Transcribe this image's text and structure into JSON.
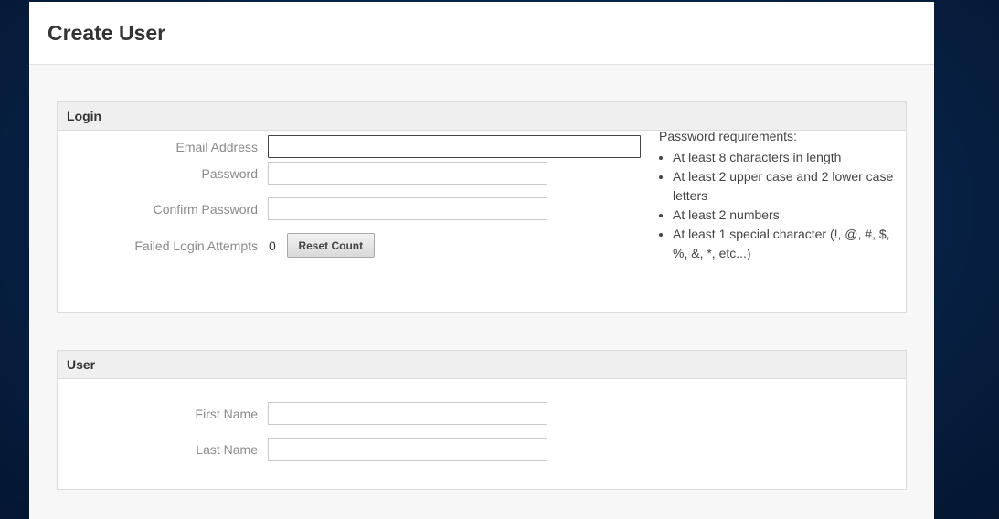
{
  "dialog": {
    "title": "Create User"
  },
  "login": {
    "heading": "Login",
    "email_label": "Email Address",
    "email_value": "",
    "password_label": "Password",
    "password_value": "",
    "confirm_label": "Confirm Password",
    "confirm_value": "",
    "failed_label": "Failed Login Attempts",
    "failed_count": "0",
    "reset_label": "Reset Count",
    "requirements_title": "Password requirements:",
    "requirements": [
      "At least 8 characters in length",
      "At least 2 upper case and 2 lower case letters",
      "At least 2 numbers",
      "At least 1 special character (!, @, #, $, %, &, *, etc...)"
    ]
  },
  "user": {
    "heading": "User",
    "first_label": "First Name",
    "first_value": "",
    "last_label": "Last Name",
    "last_value": ""
  }
}
